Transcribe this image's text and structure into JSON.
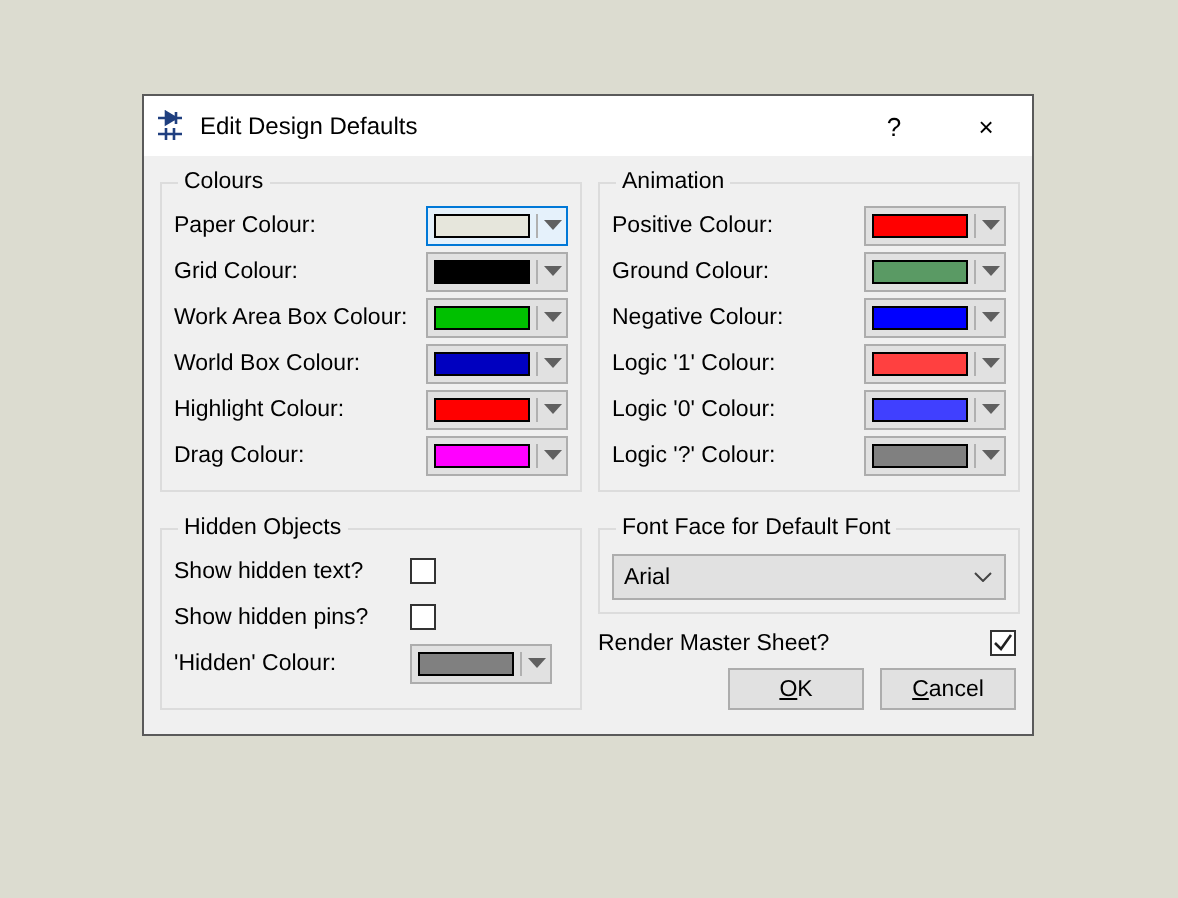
{
  "window": {
    "title": "Edit Design Defaults",
    "help": "?",
    "close": "×"
  },
  "colours": {
    "title": "Colours",
    "rows": [
      {
        "label": "Paper Colour:",
        "color": "#e6e6dc",
        "focused": true
      },
      {
        "label": "Grid Colour:",
        "color": "#000000",
        "focused": false
      },
      {
        "label": "Work Area Box Colour:",
        "color": "#00c000",
        "focused": false
      },
      {
        "label": "World Box Colour:",
        "color": "#0000c0",
        "focused": false
      },
      {
        "label": "Highlight Colour:",
        "color": "#ff0000",
        "focused": false
      },
      {
        "label": "Drag Colour:",
        "color": "#ff00ff",
        "focused": false
      }
    ]
  },
  "animation": {
    "title": "Animation",
    "rows": [
      {
        "label": "Positive Colour:",
        "color": "#ff0000",
        "focused": false
      },
      {
        "label": "Ground Colour:",
        "color": "#5a9a64",
        "focused": false
      },
      {
        "label": "Negative Colour:",
        "color": "#0000ff",
        "focused": false
      },
      {
        "label": "Logic '1' Colour:",
        "color": "#ff4040",
        "focused": false
      },
      {
        "label": "Logic '0' Colour:",
        "color": "#4040ff",
        "focused": false
      },
      {
        "label": "Logic '?' Colour:",
        "color": "#808080",
        "focused": false
      }
    ]
  },
  "hidden_objects": {
    "title": "Hidden Objects",
    "checks": [
      {
        "label": "Show hidden text?",
        "checked": false
      },
      {
        "label": "Show hidden pins?",
        "checked": false
      }
    ],
    "colour": {
      "label": "'Hidden' Colour:",
      "color": "#808080",
      "focused": false
    }
  },
  "font_face": {
    "title": "Font Face for Default Font",
    "value": "Arial"
  },
  "render_master": {
    "label": "Render Master Sheet?",
    "checked": true
  },
  "buttons": [
    {
      "label": "OK"
    },
    {
      "label": "Cancel"
    }
  ]
}
